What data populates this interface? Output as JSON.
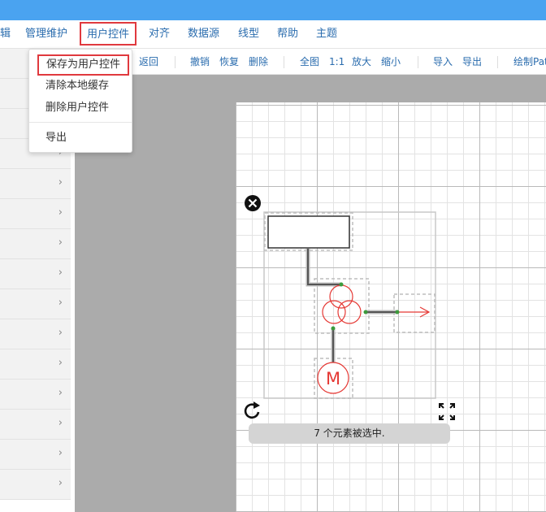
{
  "menubar": {
    "items": [
      {
        "label": "辑"
      },
      {
        "label": "管理维护"
      },
      {
        "label": "用户控件"
      },
      {
        "label": "对齐"
      },
      {
        "label": "数据源"
      },
      {
        "label": "线型"
      },
      {
        "label": "帮助"
      },
      {
        "label": "主题"
      }
    ]
  },
  "dropdown": {
    "items": [
      {
        "label": "保存为用户控件"
      },
      {
        "label": "清除本地缓存"
      },
      {
        "label": "删除用户控件"
      },
      {
        "label": "导出"
      }
    ]
  },
  "toolbar": {
    "back": "返回",
    "undo": "撤销",
    "redo": "恢复",
    "delete": "删除",
    "fit_all": "全图",
    "actual_size": "1:1",
    "zoom_in": "放大",
    "zoom_out": "缩小",
    "import": "导入",
    "export": "导出",
    "draw_path": "绘制Path"
  },
  "diagram": {
    "motor_label": "M",
    "symbol_color": "#e53935",
    "selection_count": 7
  },
  "status": {
    "text": "7 个元素被选中."
  },
  "colors": {
    "topbar": "#4aa3f0",
    "menu_text": "#2a6cae",
    "highlight_border": "#e0393e"
  }
}
